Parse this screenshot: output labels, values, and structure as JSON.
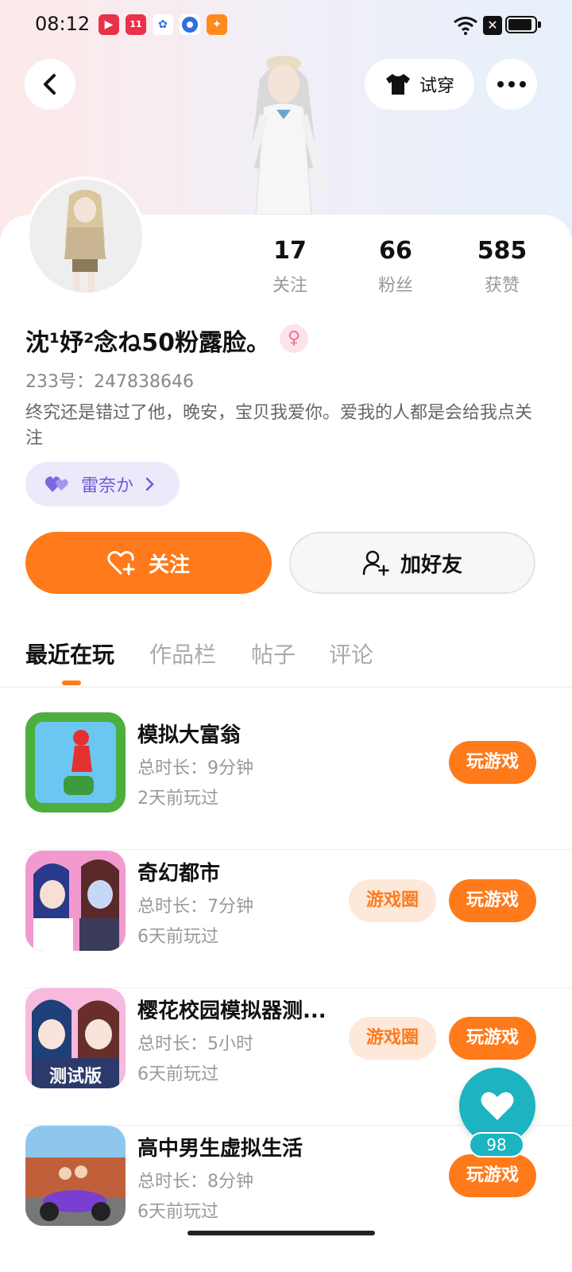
{
  "status_bar": {
    "time": "08:12",
    "notif_icons": [
      "video-app-icon",
      "shopping-app-icon",
      "baidu-icon",
      "browser-icon",
      "game-app-icon"
    ]
  },
  "header": {
    "back": "back-icon",
    "try_on_label": "试穿",
    "more": "more-icon"
  },
  "stats": [
    {
      "value": "17",
      "label": "关注"
    },
    {
      "value": "66",
      "label": "粉丝"
    },
    {
      "value": "585",
      "label": "获赞"
    }
  ],
  "profile": {
    "name": "沈¹妤²念ね50粉露脸。",
    "gender_icon": "♀",
    "uid": "233号：247838646",
    "bio": "终究还是错过了他，晚安，宝贝我爱你。爱我的人都是会给我点关注",
    "tag_label": "雷奈か"
  },
  "actions": {
    "follow_label": "关注",
    "add_friend_label": "加好友"
  },
  "tabs": [
    "最近在玩",
    "作品栏",
    "帖子",
    "评论"
  ],
  "games": [
    {
      "title": "模拟大富翁",
      "duration": "总时长：9分钟",
      "ago": "2天前玩过",
      "circle": "",
      "play": "玩游戏"
    },
    {
      "title": "奇幻都市",
      "duration": "总时长：7分钟",
      "ago": "6天前玩过",
      "circle": "游戏圈",
      "play": "玩游戏"
    },
    {
      "title": "樱花校园模拟器测...",
      "duration": "总时长：5小时",
      "ago": "6天前玩过",
      "circle": "游戏圈",
      "play": "玩游戏"
    },
    {
      "title": "高中男生虚拟生活",
      "duration": "总时长：8分钟",
      "ago": "6天前玩过",
      "circle": "",
      "play": "玩游戏"
    }
  ],
  "fab": {
    "count": "98"
  },
  "colors": {
    "accent": "#ff7a1a",
    "teal": "#1bb4c0",
    "purple": "#6a5bd4"
  }
}
